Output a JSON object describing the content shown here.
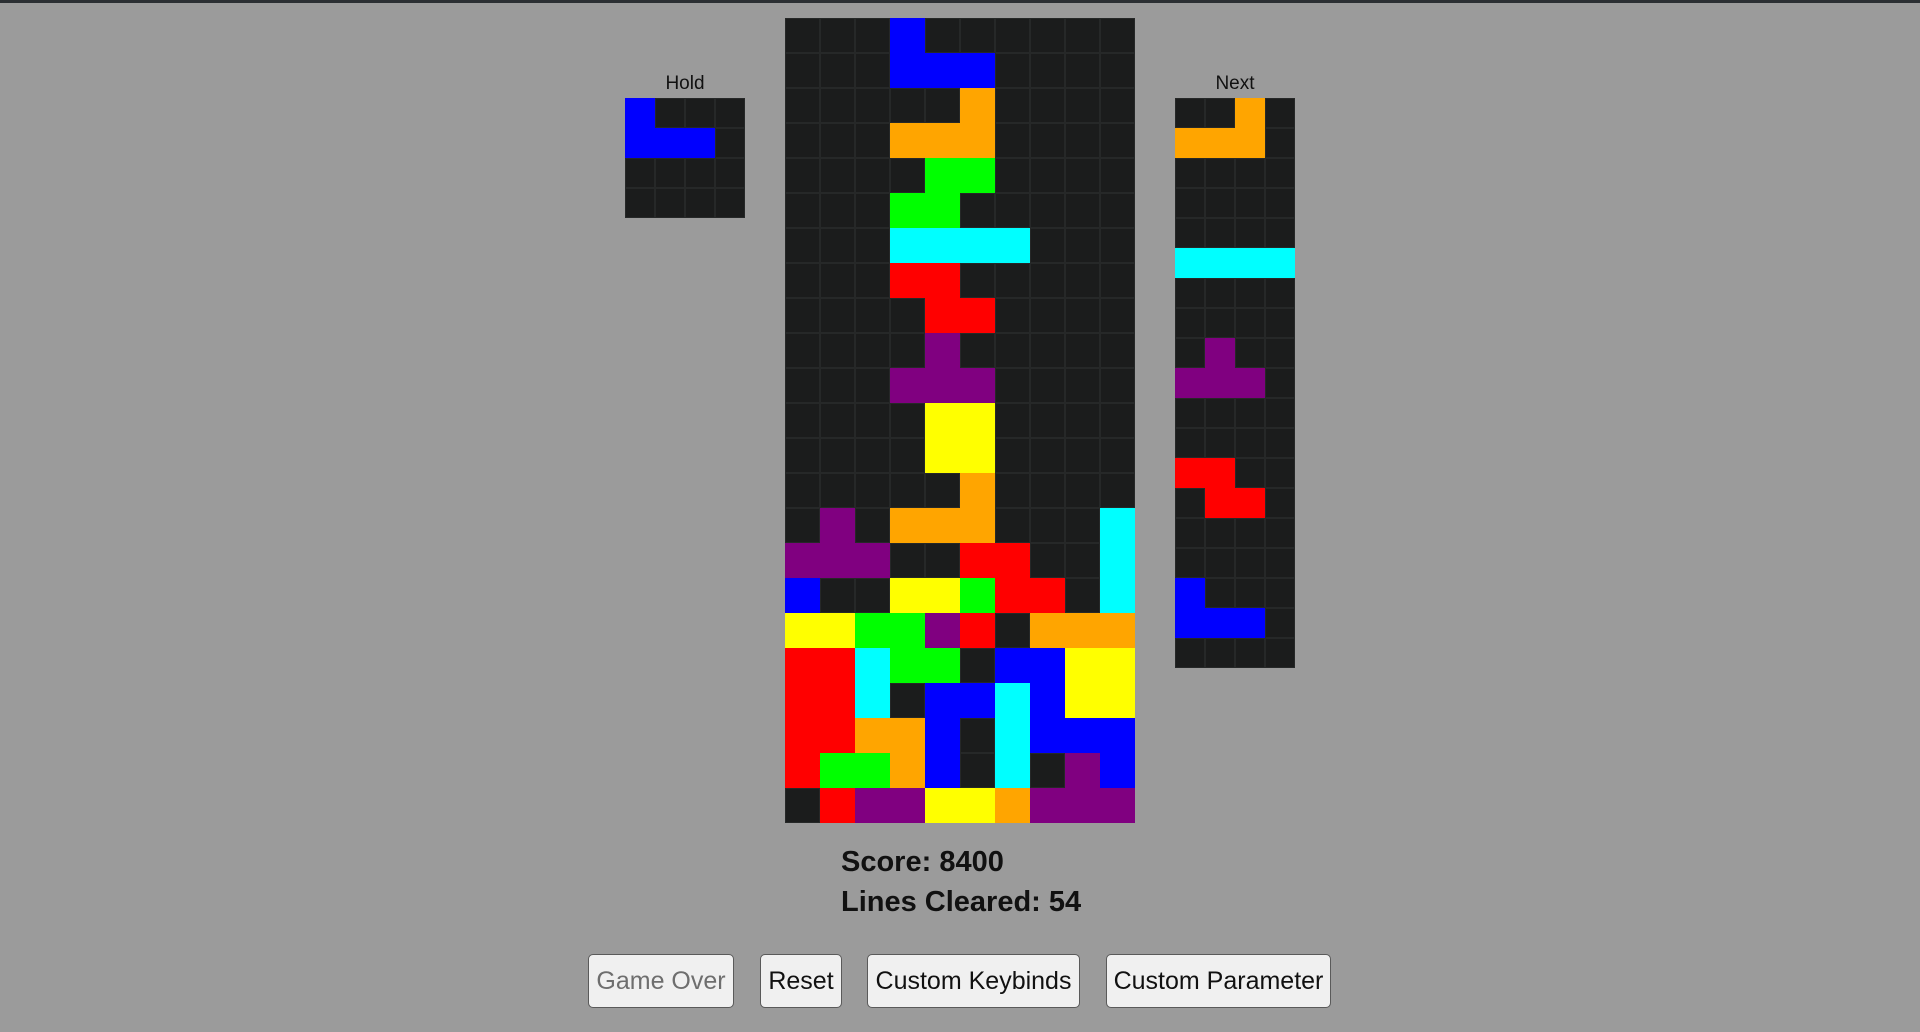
{
  "colors": {
    "background": "#9b9b9b",
    "empty": "#1b1c1c",
    "gridline": "#262828",
    "pieces": {
      "I": "#00ffff",
      "O": "#ffff00",
      "T": "#800080",
      "S": "#00ff00",
      "Z": "#ff0000",
      "J": "#0000ff",
      "L": "#ffa500"
    }
  },
  "hold": {
    "label": "Hold",
    "piece": "J",
    "grid": [
      "J...",
      "JJJ.",
      "....",
      "...."
    ]
  },
  "next": {
    "label": "Next",
    "queue": [
      "L",
      "I",
      "T",
      "Z",
      "J"
    ],
    "grid": [
      "..L.",
      "LLL.",
      "....",
      "....",
      "....",
      "IIII",
      "....",
      "....",
      ".T..",
      "TTT.",
      "....",
      "....",
      "ZZ..",
      ".ZZ.",
      "....",
      "....",
      "J...",
      "JJJ.",
      "...."
    ]
  },
  "board": {
    "columns": 10,
    "rows": 23,
    "grid": [
      "...J......",
      "...JJJ....",
      ".....L....",
      "...LLL....",
      "....SS....",
      "...SS.....",
      "...IIII...",
      "...ZZ.....",
      "....ZZ....",
      "....T.....",
      "...TTT....",
      "....OO....",
      "....OO....",
      ".....L....",
      ".T.LLL...I",
      "TTT..ZZ..I",
      "J..OOSZZ.I",
      "OOSSTZ.LLL",
      "ZZISS.JJOO",
      "ZZI.JJIJOO",
      "ZZLLJ.IJJJ",
      "ZSSLJ.I.TJ",
      ".ZTTOOLTTT"
    ]
  },
  "stats": {
    "score_text": "Score: 8400",
    "lines_text": "Lines Cleared: 54"
  },
  "buttons": {
    "game_over": "Game Over",
    "reset": "Reset",
    "custom_keybinds": "Custom Keybinds",
    "custom_parameter": "Custom Parameter"
  }
}
